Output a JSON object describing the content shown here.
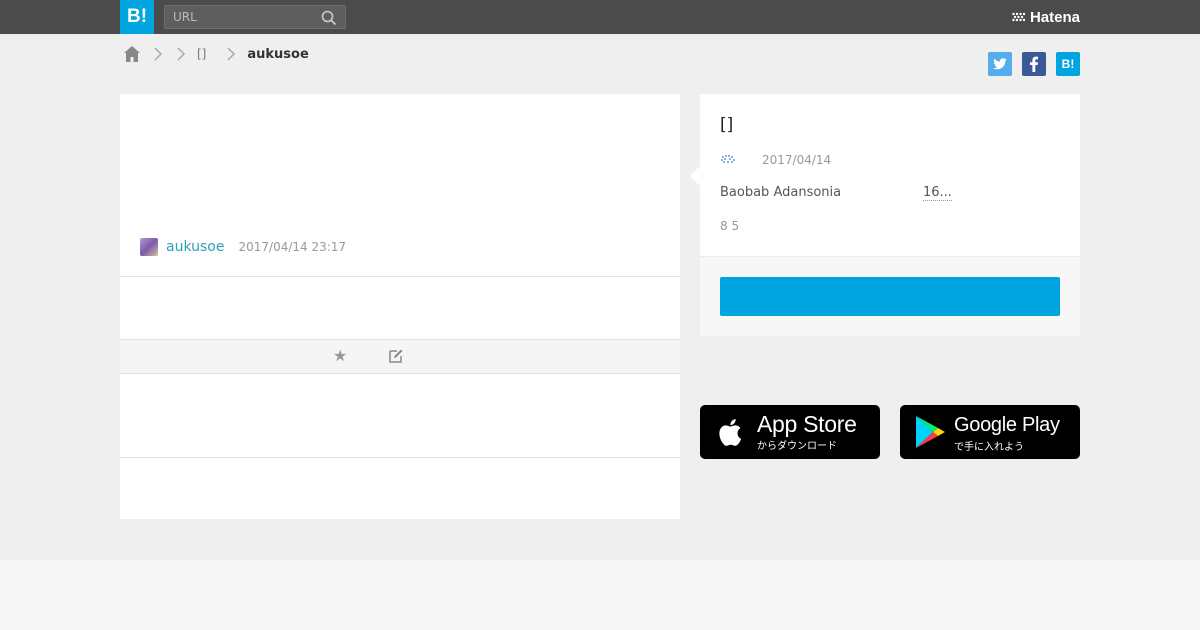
{
  "header": {
    "logo": "B!",
    "search_placeholder": "URL",
    "brand": "Hatena"
  },
  "breadcrumb": {
    "category": "[]",
    "current": "aukusoe"
  },
  "share": {
    "hatena_label": "B!"
  },
  "entry": {
    "user": "aukusoe",
    "timestamp": "2017/04/14 23:17",
    "star": "★"
  },
  "card": {
    "title": "[]",
    "date": "2017/04/14",
    "description": "Baobab  Adansonia",
    "more": "16...",
    "counts": "8 5",
    "button_label": ""
  },
  "apps": {
    "apple_title": "App Store",
    "apple_sub": "からダウンロード",
    "google_title": "Google Play",
    "google_sub": "で手に入れよう"
  },
  "colors": {
    "accent": "#00a4de",
    "header": "#4b4b4b",
    "user_link": "#2e9fb6"
  }
}
